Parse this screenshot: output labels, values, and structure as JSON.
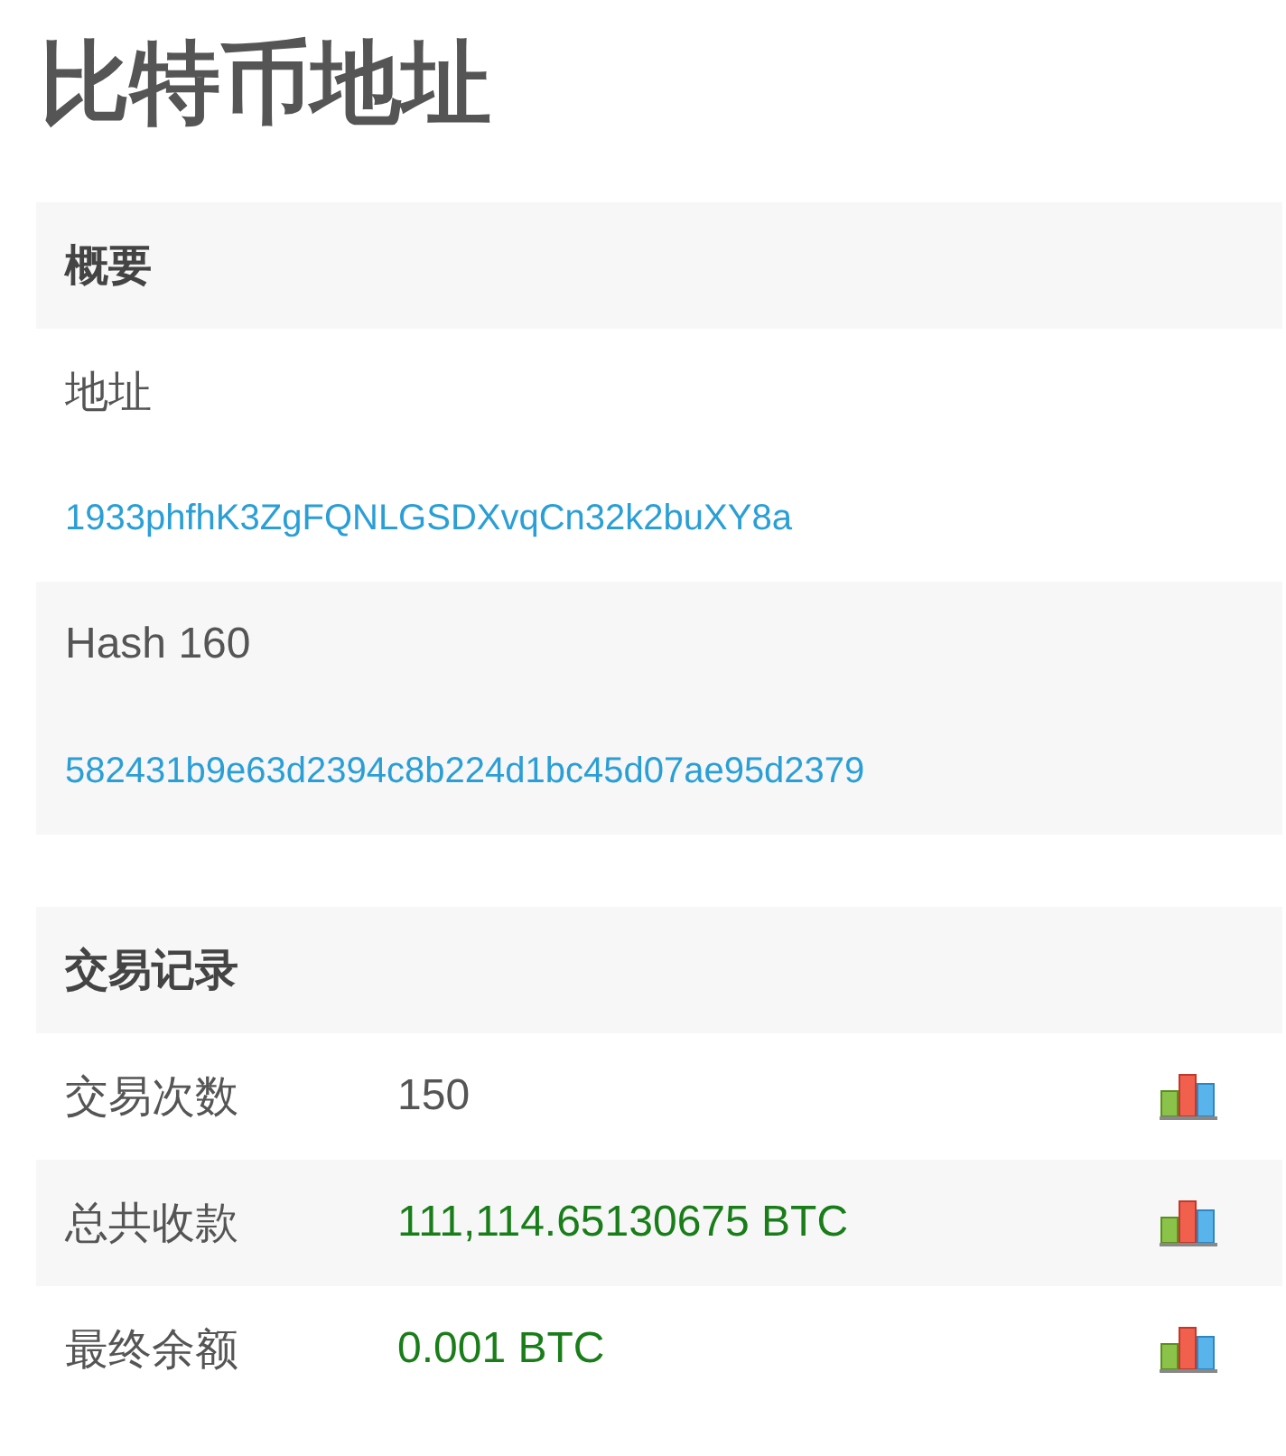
{
  "title": "比特币地址",
  "summary": {
    "heading": "概要",
    "fields": [
      {
        "label": "地址",
        "value": "1933phfhK3ZgFQNLGSDXvqCn32k2buXY8a"
      },
      {
        "label": "Hash 160",
        "value": "582431b9e63d2394c8b224d1bc45d07ae95d2379"
      }
    ]
  },
  "transactions": {
    "heading": "交易记录",
    "rows": [
      {
        "label": "交易次数",
        "value": "150",
        "kind": "count"
      },
      {
        "label": "总共收款",
        "value": "111,114.65130675 BTC",
        "kind": "amount"
      },
      {
        "label": "最终余额",
        "value": "0.001 BTC",
        "kind": "amount"
      }
    ]
  }
}
